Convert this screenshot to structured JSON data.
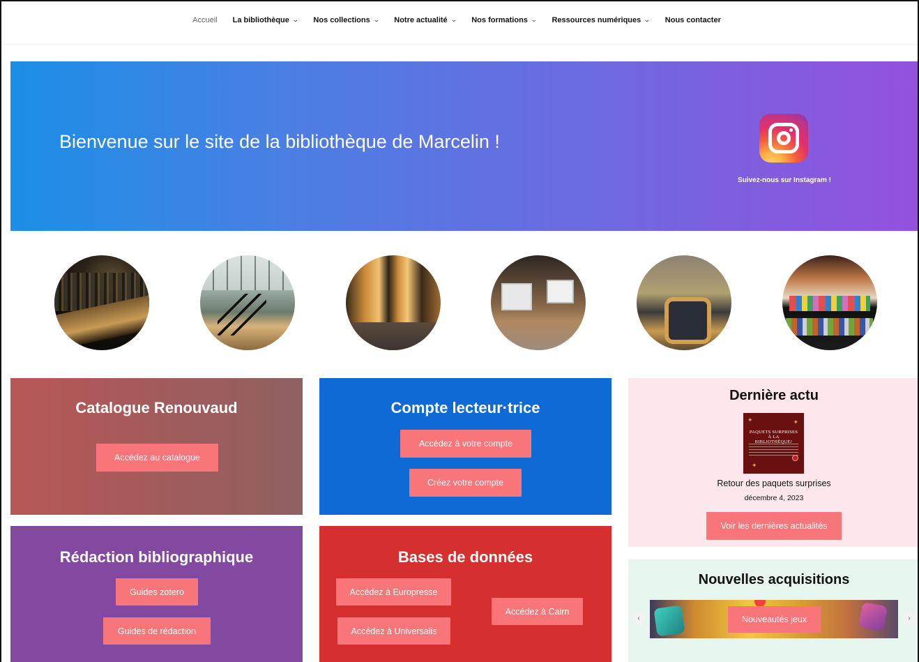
{
  "nav": {
    "items": [
      {
        "label": "Accueil",
        "has_dropdown": false,
        "active": true
      },
      {
        "label": "La bibliothèque",
        "has_dropdown": true
      },
      {
        "label": "Nos collections",
        "has_dropdown": true
      },
      {
        "label": "Notre actualité",
        "has_dropdown": true
      },
      {
        "label": "Nos formations",
        "has_dropdown": true
      },
      {
        "label": "Ressources numériques",
        "has_dropdown": true
      },
      {
        "label": "Nous contacter",
        "has_dropdown": false
      }
    ],
    "chevron": "⌄"
  },
  "hero": {
    "title": "Bienvenue sur le site de la bibliothèque de Marcelin !",
    "instagram_label": "Suivez-nous sur Instagram !",
    "instagram_icon": "instagram-icon"
  },
  "gallery": {
    "count": 6
  },
  "catalogue": {
    "title": "Catalogue Renouvaud",
    "button": "Accédez au catalogue"
  },
  "compte": {
    "title": "Compte lecteur·trice",
    "button_access": "Accédez à votre compte",
    "button_create": "Créez votre compte"
  },
  "actu": {
    "title": "Dernière actu",
    "image_text": "PAQUETS SURPRISES À LA BIBLIOTHÈQUE!",
    "post_title": "Retour des paquets surprises",
    "post_date": "décembre 4, 2023",
    "button": "Voir les dernières actualités"
  },
  "redaction": {
    "title": "Rédaction bibliographique",
    "button_zotero": "Guides zotero",
    "button_redaction": "Guides de rédaction"
  },
  "bases": {
    "title": "Bases de données",
    "button_europresse": "Accédez à Europresse",
    "button_universalis": "Accédez à Universalis",
    "button_cairn": "Accédez à Cairn"
  },
  "acquisitions": {
    "title": "Nouvelles acquisitions",
    "slide_button": "Nouveautés jeux",
    "prev": "‹",
    "next": "›"
  },
  "colors": {
    "accent_button": "#f87679",
    "catalogue_bg": "#a35b5b",
    "compte_bg": "#0f6ad6",
    "redaction_bg": "#8349a0",
    "bases_bg": "#d62f2f",
    "actu_bg": "#fde6ec",
    "acquisitions_bg": "#e6f6ee"
  }
}
